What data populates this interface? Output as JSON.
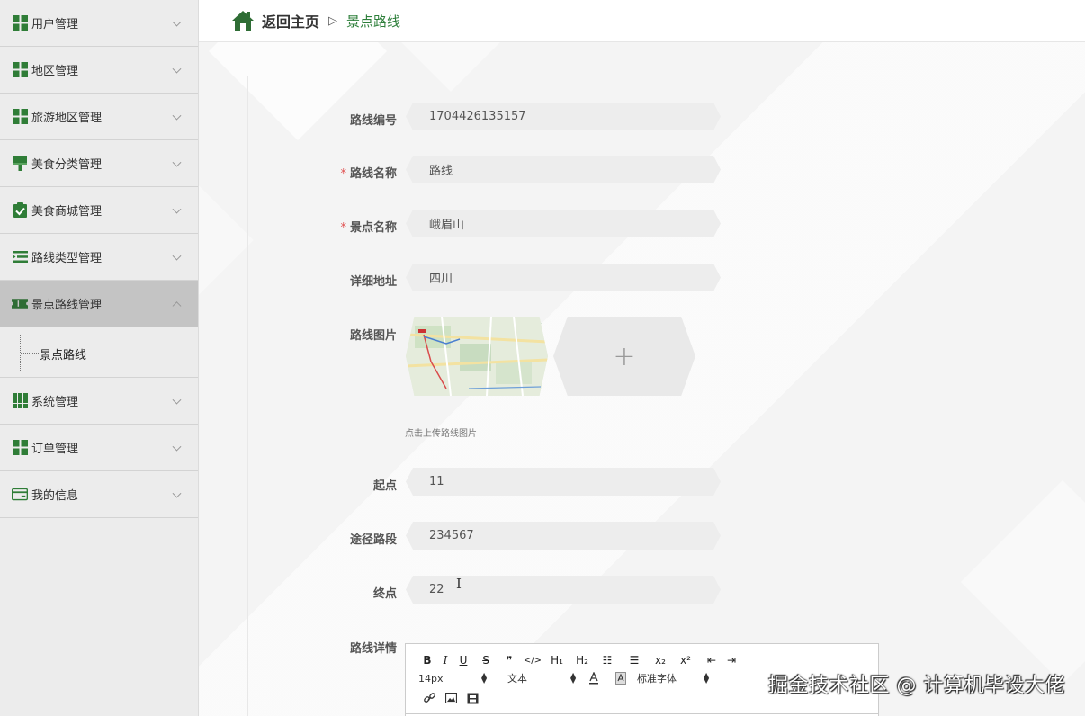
{
  "sidebar": {
    "items": [
      {
        "label": "用户管理",
        "icon": "grid-icon",
        "expanded": false
      },
      {
        "label": "地区管理",
        "icon": "grid-icon",
        "expanded": false
      },
      {
        "label": "旅游地区管理",
        "icon": "grid-icon",
        "expanded": false
      },
      {
        "label": "美食分类管理",
        "icon": "brush-icon",
        "expanded": false
      },
      {
        "label": "美食商城管理",
        "icon": "clipboard-check-icon",
        "expanded": false
      },
      {
        "label": "路线类型管理",
        "icon": "list-icon",
        "expanded": false
      },
      {
        "label": "景点路线管理",
        "icon": "ticket-icon",
        "expanded": true,
        "active": true
      },
      {
        "label": "系统管理",
        "icon": "grid-9-icon",
        "expanded": false
      },
      {
        "label": "订单管理",
        "icon": "grid-icon",
        "expanded": false
      },
      {
        "label": "我的信息",
        "icon": "card-icon",
        "expanded": false
      }
    ],
    "submenu": {
      "label": "景点路线"
    }
  },
  "topbar": {
    "home": "返回主页",
    "separator": "▷",
    "current": "景点路线"
  },
  "form": {
    "route_no": {
      "label": "路线编号",
      "value": "1704426135157"
    },
    "route_name": {
      "label": "路线名称",
      "value": "路线",
      "required": true
    },
    "spot_name": {
      "label": "景点名称",
      "value": "峨眉山",
      "required": true
    },
    "address": {
      "label": "详细地址",
      "value": "四川"
    },
    "image": {
      "label": "路线图片",
      "hint": "点击上传路线图片",
      "upload": "+"
    },
    "start": {
      "label": "起点",
      "value": "11"
    },
    "via": {
      "label": "途径路段",
      "value": "234567"
    },
    "end": {
      "label": "终点",
      "value": "22"
    },
    "detail": {
      "label": "路线详情"
    }
  },
  "editor": {
    "row1": [
      "B",
      "I",
      "U",
      "S",
      "❞",
      "</>",
      "H₁",
      "H₂",
      "☷",
      "☰",
      "x₂",
      "x²",
      "⇤",
      "⇥"
    ],
    "font_size": "14px",
    "text_style": "文本",
    "font_family": "标准字体"
  },
  "required_mark": "*",
  "watermark": "掘金技术社区 @ 计算机毕设大佬",
  "colors": {
    "accent": "#2d7f3a",
    "sidebar_bg": "#ececec",
    "active_bg": "#c4c4c4",
    "required": "#e05050"
  }
}
